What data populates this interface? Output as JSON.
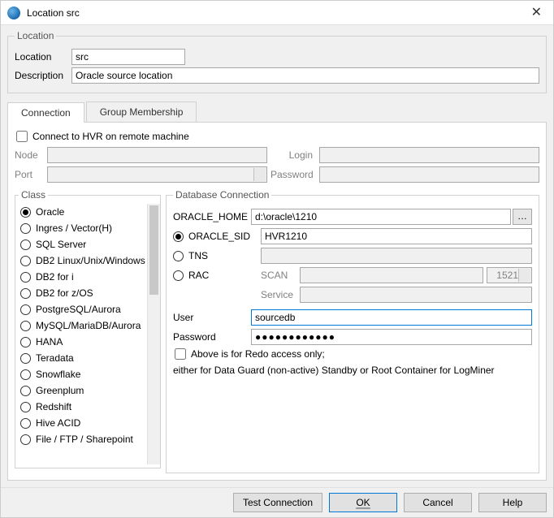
{
  "title": "Location src",
  "location_group": {
    "legend": "Location",
    "location_label": "Location",
    "location_value": "src",
    "description_label": "Description",
    "description_value": "Oracle source location"
  },
  "tabs": {
    "connection": "Connection",
    "group_membership": "Group Membership"
  },
  "remote": {
    "chk_label": "Connect to HVR on remote machine",
    "node_label": "Node",
    "port_label": "Port",
    "login_label": "Login",
    "password_label": "Password"
  },
  "class": {
    "legend": "Class",
    "items": [
      "Oracle",
      "Ingres / Vector(H)",
      "SQL Server",
      "DB2 Linux/Unix/Windows",
      "DB2 for i",
      "DB2 for z/OS",
      "PostgreSQL/Aurora",
      "MySQL/MariaDB/Aurora",
      "HANA",
      "Teradata",
      "Snowflake",
      "Greenplum",
      "Redshift",
      "Hive ACID",
      "File / FTP / Sharepoint"
    ],
    "selected": 0
  },
  "db": {
    "legend": "Database Connection",
    "oracle_home_label": "ORACLE_HOME",
    "oracle_home_value": "d:\\oracle\\1210",
    "sid_label": "ORACLE_SID",
    "sid_value": "HVR1210",
    "tns_label": "TNS",
    "rac_label": "RAC",
    "scan_label": "SCAN",
    "scan_port": "1521",
    "service_label": "Service",
    "user_label": "User",
    "user_value": "sourcedb",
    "password_label": "Password",
    "password_value": "●●●●●●●●●●●●",
    "redo_chk": "Above is for Redo access only;",
    "redo_hint": "either for Data Guard (non-active) Standby or Root Container for LogMiner"
  },
  "buttons": {
    "test": "Test Connection",
    "ok": "OK",
    "cancel": "Cancel",
    "help": "Help"
  }
}
